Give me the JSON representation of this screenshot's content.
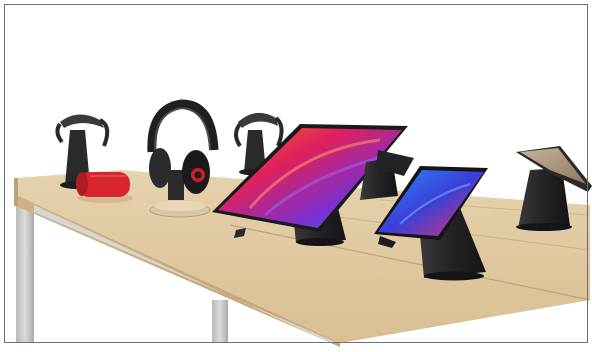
{
  "scene": {
    "subject": "retail-display-table",
    "products": [
      "headphone-stand",
      "over-ear-headphones",
      "bluetooth-speaker",
      "tablet",
      "smartphone",
      "device-stand"
    ],
    "colors": {
      "background": "#ffffff",
      "table_top": "#e0c9a2",
      "table_edge": "#c9ad7e",
      "table_leg": "#c7c7c4",
      "stand": "#2c2c2e",
      "speaker": "#d8252e",
      "tablet_screen_a": "#d81f4d",
      "tablet_screen_b": "#3a57d6",
      "phone_screen_a": "#2c6fff",
      "phone_screen_b": "#e23c6e"
    }
  }
}
